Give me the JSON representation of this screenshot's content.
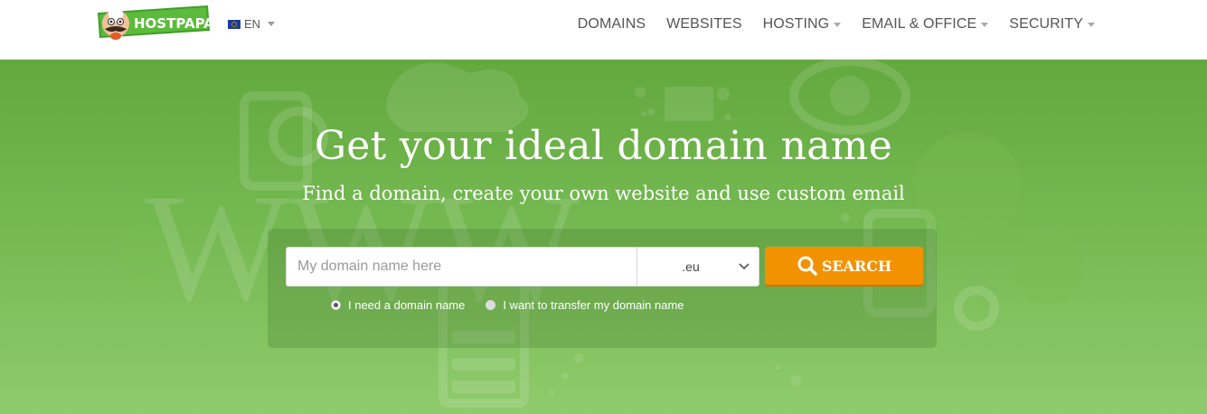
{
  "header": {
    "logo_text": "HOSTPAPA",
    "language": {
      "code": "EN",
      "flag": "eu-flag-icon"
    },
    "nav": [
      {
        "label": "DOMAINS",
        "dropdown": false
      },
      {
        "label": "WEBSITES",
        "dropdown": false
      },
      {
        "label": "HOSTING",
        "dropdown": true
      },
      {
        "label": "EMAIL & OFFICE",
        "dropdown": true
      },
      {
        "label": "SECURITY",
        "dropdown": true
      }
    ]
  },
  "hero": {
    "title": "Get your ideal domain name",
    "subtitle": "Find a domain, create your own website and use custom email",
    "search": {
      "placeholder": "My domain name here",
      "value": "",
      "tld_selected": ".eu",
      "button_label": "SEARCH"
    },
    "options": [
      {
        "label": "I need a domain name",
        "selected": true
      },
      {
        "label": "I want to transfer my domain name",
        "selected": false
      }
    ]
  },
  "colors": {
    "hero_green": "#6aae45",
    "accent_orange": "#f39200",
    "nav_text": "#555555",
    "logo_green": "#4caf2a"
  }
}
